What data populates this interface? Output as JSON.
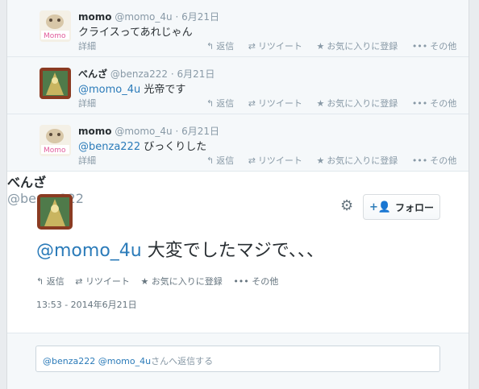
{
  "replies": [
    {
      "name": "momo",
      "handle": "@momo_4u",
      "date": "6月21日",
      "mention": "",
      "text": "クライスってあれじゃん",
      "detail": "詳細",
      "avatar": "momo-avatar"
    },
    {
      "name": "べんざ",
      "handle": "@benza222",
      "date": "6月21日",
      "mention": "@momo_4u",
      "text": " 光帝です",
      "detail": "詳細",
      "avatar": "benza-avatar"
    },
    {
      "name": "momo",
      "handle": "@momo_4u",
      "date": "6月21日",
      "mention": "@benza222",
      "text": " びっくりした",
      "detail": "詳細",
      "avatar": "momo-avatar"
    }
  ],
  "actions": {
    "reply": "返信",
    "retweet": "リツイート",
    "favorite": "お気に入りに登録",
    "more": "その他"
  },
  "icons": {
    "reply": "reply-icon",
    "retweet": "retweet-icon",
    "favorite": "star-icon",
    "more": "more-dots-icon",
    "settings": "gear-icon",
    "follow": "add-user-icon"
  },
  "main_tweet": {
    "name": "べんざ",
    "handle": "@benza222",
    "mention": "@momo_4u",
    "text": " 大変でしたマジで、、、",
    "follow_label": "フォロー",
    "timestamp": "13:53 - 2014年6月21日"
  },
  "reply_box": {
    "mentions": "@benza222 @momo_4u",
    "suffix": "さんへ返信する"
  },
  "colors": {
    "accent": "#2b7bb9",
    "muted": "#8899a6"
  }
}
